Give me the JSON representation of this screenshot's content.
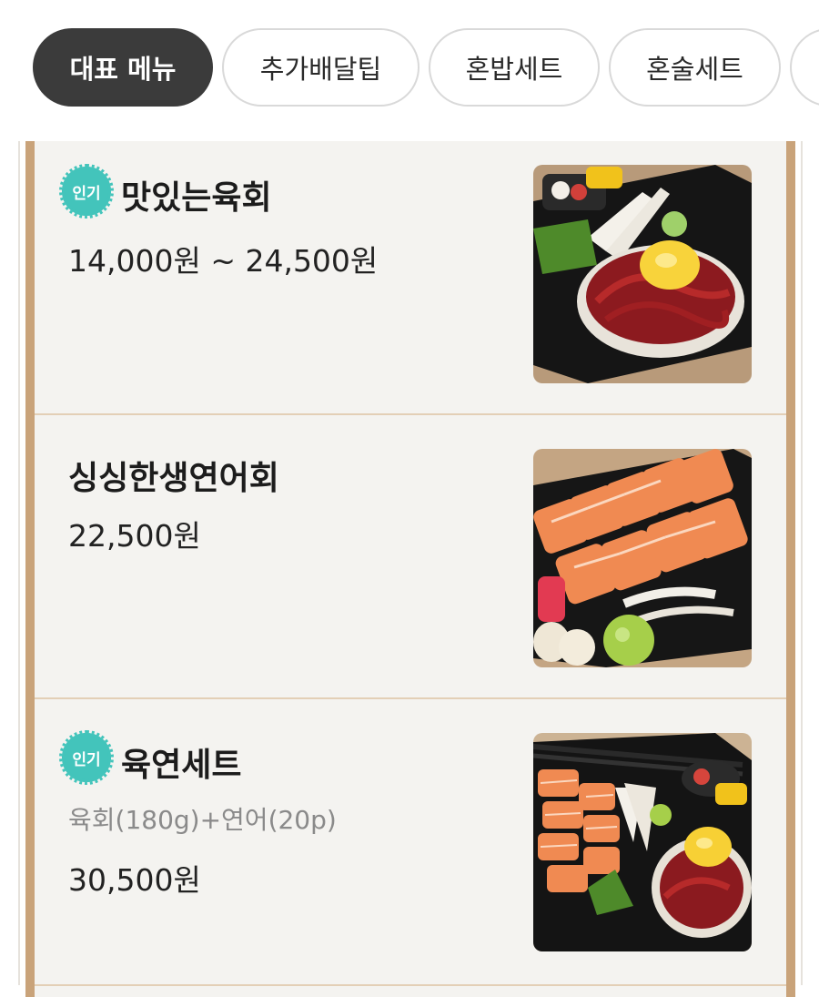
{
  "tabs": [
    {
      "label": "대표 메뉴",
      "active": true
    },
    {
      "label": "추가배달팁",
      "active": false
    },
    {
      "label": "혼밥세트",
      "active": false
    },
    {
      "label": "혼술세트",
      "active": false
    }
  ],
  "menu": {
    "items": [
      {
        "badge": "인기",
        "name": "맛있는육회",
        "desc": "",
        "price": "14,000원 ~ 24,500원",
        "photo_icon": "yukhoe-photo"
      },
      {
        "badge": "",
        "name": "싱싱한생연어회",
        "desc": "",
        "price": "22,500원",
        "photo_icon": "salmon-sashimi-photo"
      },
      {
        "badge": "인기",
        "name": "육연세트",
        "desc": "육회(180g)+연어(20p)",
        "price": "30,500원",
        "photo_icon": "combo-set-photo"
      }
    ]
  },
  "colors": {
    "active_tab_bg": "#3b3b3b",
    "badge": "#43c4bb",
    "board_frame": "#c9a37a",
    "board_bg": "#f4f3f0"
  }
}
